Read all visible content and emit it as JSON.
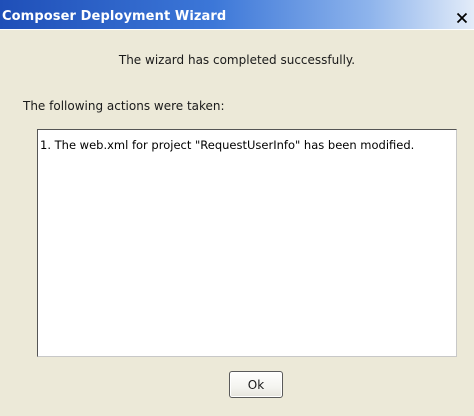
{
  "window": {
    "title": "Composer Deployment Wizard",
    "close_icon": "close-x-icon"
  },
  "message": {
    "status": "The wizard has completed successfully.",
    "actions_label": "The following actions were taken:"
  },
  "actions": {
    "items": [
      "1. The web.xml for project \"RequestUserInfo\" has been modified."
    ]
  },
  "buttons": {
    "ok_label": "Ok"
  }
}
